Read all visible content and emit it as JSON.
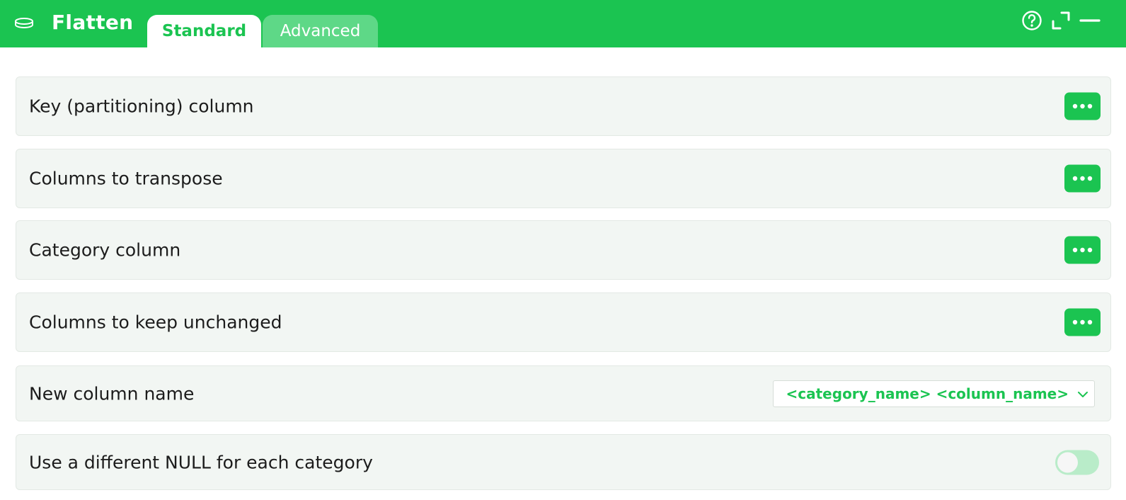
{
  "header": {
    "app_icon": "database-disk-icon",
    "title": "Flatten",
    "tabs": [
      {
        "label": "Standard",
        "active": true
      },
      {
        "label": "Advanced",
        "active": false
      }
    ],
    "icons": [
      "help-circle-icon",
      "expand-icon",
      "minimize-icon"
    ]
  },
  "rows": [
    {
      "label": "Key (partitioning) column",
      "control": "dots-button"
    },
    {
      "label": "Columns to transpose",
      "control": "dots-button"
    },
    {
      "label": "Category column",
      "control": "dots-button"
    },
    {
      "label": "Columns to keep unchanged",
      "control": "dots-button"
    },
    {
      "label": "New column name",
      "control": "select",
      "value": "<category_name> <column_name>"
    },
    {
      "label": "Use a different NULL for each category",
      "control": "toggle",
      "checked": false
    }
  ],
  "colors": {
    "accent": "#1bc451",
    "tab_inactive": "#5ed887",
    "row_background": "#f2f6f3",
    "toggle_off": "#b9ecc9"
  }
}
